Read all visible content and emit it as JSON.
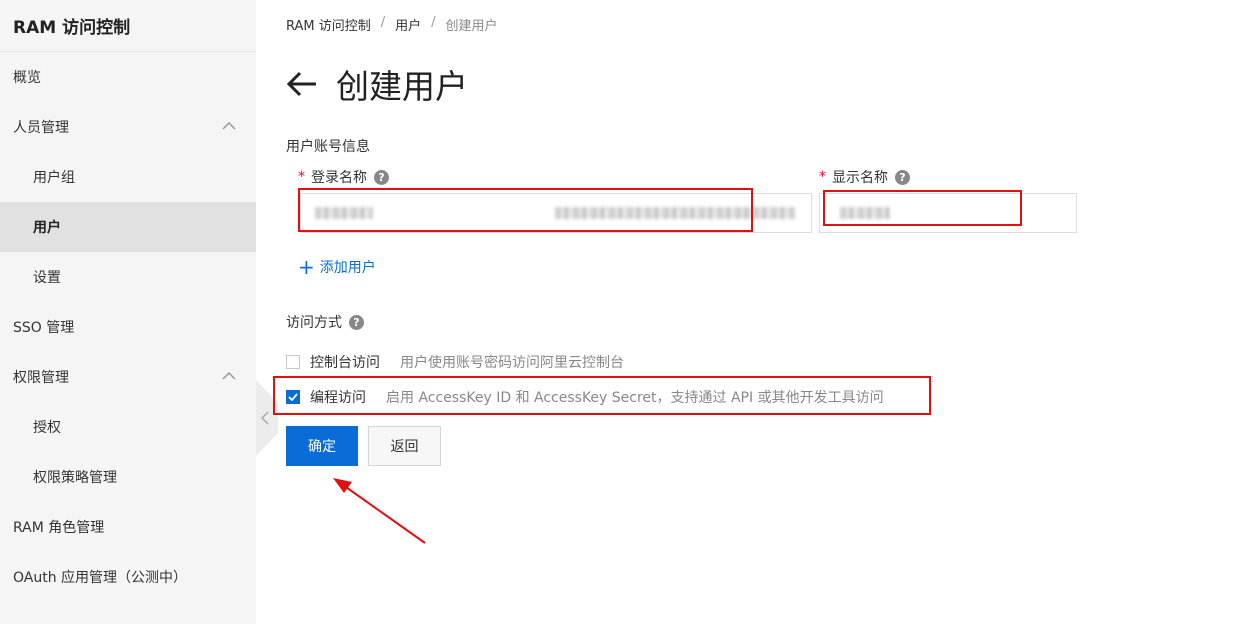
{
  "sidebar": {
    "title": "RAM 访问控制",
    "items": [
      {
        "label": "概览"
      },
      {
        "label": "人员管理"
      },
      {
        "label": "用户组"
      },
      {
        "label": "用户"
      },
      {
        "label": "设置"
      },
      {
        "label": "SSO 管理"
      },
      {
        "label": "权限管理"
      },
      {
        "label": "授权"
      },
      {
        "label": "权限策略管理"
      },
      {
        "label": "RAM 角色管理"
      },
      {
        "label": "OAuth 应用管理（公测中）"
      }
    ]
  },
  "breadcrumb": {
    "items": [
      "RAM 访问控制",
      "用户",
      "创建用户"
    ],
    "separator": "/"
  },
  "page": {
    "title": "创建用户"
  },
  "form": {
    "account_section": "用户账号信息",
    "login_name_label": "登录名称",
    "display_name_label": "显示名称",
    "required_mark": "*",
    "help_glyph": "?",
    "add_user_label": "添加用户",
    "access_section": "访问方式",
    "console_access_label": "控制台访问",
    "console_access_desc": "用户使用账号密码访问阿里云控制台",
    "console_access_checked": false,
    "api_access_label": "编程访问",
    "api_access_desc": "启用 AccessKey ID 和 AccessKey Secret，支持通过 API 或其他开发工具访问",
    "api_access_checked": true
  },
  "buttons": {
    "confirm_label": "确定",
    "back_label": "返回"
  },
  "colors": {
    "primary": "#0a6cd6",
    "annotation": "#e01010",
    "sidebar_bg": "#f5f5f6",
    "active_item_bg": "#e1e1e1"
  },
  "icons": {
    "back": "arrow-left-icon",
    "help": "question-circle-icon",
    "expand": "chevron-up-icon",
    "add": "plus-icon",
    "collapse": "chevron-left-icon"
  }
}
